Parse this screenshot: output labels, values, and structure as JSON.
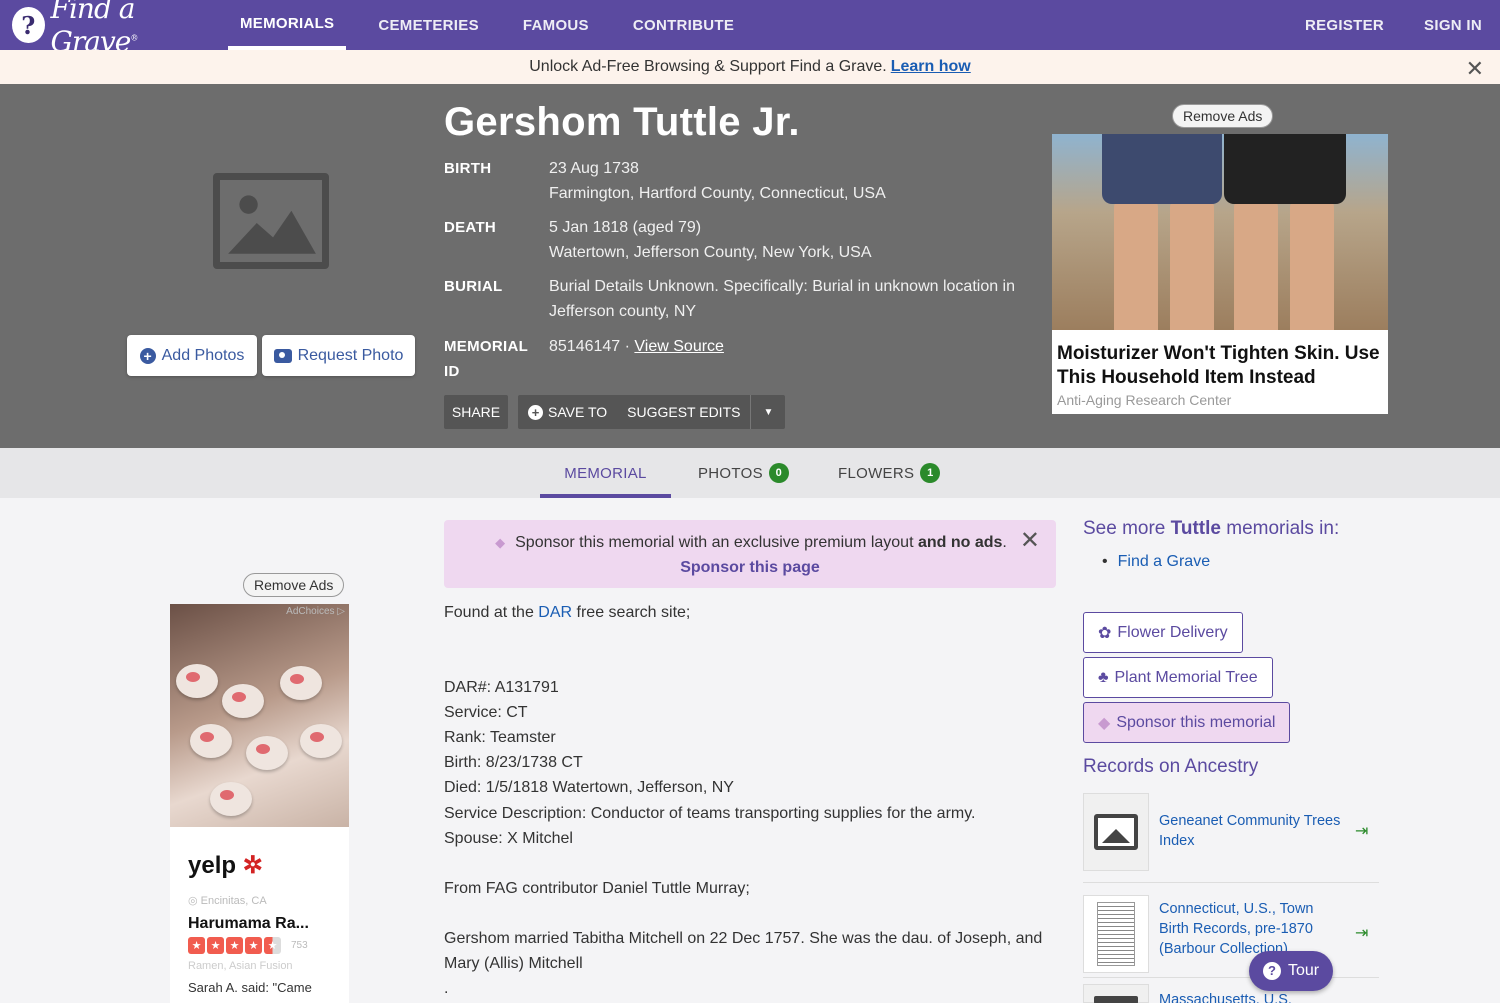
{
  "nav": {
    "logo_text": "Find a Grave",
    "logo_reg": "®",
    "items": [
      "MEMORIALS",
      "CEMETERIES",
      "FAMOUS",
      "CONTRIBUTE"
    ],
    "register": "REGISTER",
    "sign_in": "SIGN IN"
  },
  "banner": {
    "text": "Unlock Ad-Free Browsing & Support Find a Grave.",
    "link": "Learn how"
  },
  "hero": {
    "add_photos": "Add Photos",
    "request_photo": "Request Photo",
    "name": "Gershom Tuttle Jr.",
    "birth_label": "BIRTH",
    "birth_date": "23 Aug 1738",
    "birth_place": "Farmington, Hartford County, Connecticut, USA",
    "death_label": "DEATH",
    "death_date": "5 Jan 1818 (aged 79)",
    "death_place": "Watertown, Jefferson County, New York, USA",
    "burial_label": "BURIAL",
    "burial_text": "Burial Details Unknown. Specifically: Burial in unknown location in Jefferson county, NY",
    "memorial_label_1": "MEMORIAL",
    "memorial_label_2": "ID",
    "memorial_id": "85146147 ·",
    "view_source": "View Source",
    "share": "SHARE",
    "save_to": "SAVE TO",
    "suggest_edits": "SUGGEST EDITS"
  },
  "ad_hero": {
    "remove_ads": "Remove Ads",
    "title": "Moisturizer Won't Tighten Skin. Use This Household Item Instead",
    "source": "Anti-Aging Research Center"
  },
  "tabs": {
    "memorial": "MEMORIAL",
    "photos": "PHOTOS",
    "photos_count": "0",
    "flowers": "FLOWERS",
    "flowers_count": "1"
  },
  "ad_left": {
    "remove_ads": "Remove Ads",
    "adchoices": "AdChoices ▷",
    "brand": "yelp",
    "location": "Encinitas, CA",
    "business": "Harumama Ra...",
    "reviews": "753",
    "category": "Ramen, Asian Fusion",
    "quote": "Sarah A. said: \"Came"
  },
  "sponsor": {
    "text_1": "Sponsor this memorial with an exclusive premium layout",
    "text_bold": "and no ads",
    "text_end": ".",
    "link": "Sponsor this page"
  },
  "bio": {
    "intro_pre": "Found at the",
    "intro_link": "DAR",
    "intro_post": "free search site;",
    "lines": [
      "DAR#: A131791",
      "Service: CT",
      "Rank: Teamster",
      "Birth: 8/23/1738 CT",
      "Died: 1/5/1818 Watertown, Jefferson, NY",
      "Service Description: Conductor of teams transporting supplies for the army.",
      "Spouse: X Mitchel"
    ],
    "contributor": "From FAG contributor Daniel Tuttle Murray;",
    "married": "Gershom married Tabitha Mitchell on 22 Dec 1757. She was the dau. of Joseph, and Mary (Allis) Mitchell",
    "tail": "."
  },
  "side": {
    "see_more_pre": "See more",
    "see_more_name": "Tuttle",
    "see_more_post": "memorials in:",
    "see_more_link": "Find a Grave",
    "flower_delivery": "Flower Delivery",
    "plant_tree": "Plant Memorial Tree",
    "sponsor_memorial": "Sponsor this memorial",
    "records_title": "Records on Ancestry",
    "records": [
      "Geneanet Community Trees Index",
      "Connecticut, U.S., Town Birth Records, pre-1870 (Barbour Collection)",
      "Massachusetts, U.S."
    ]
  },
  "tour": "Tour"
}
